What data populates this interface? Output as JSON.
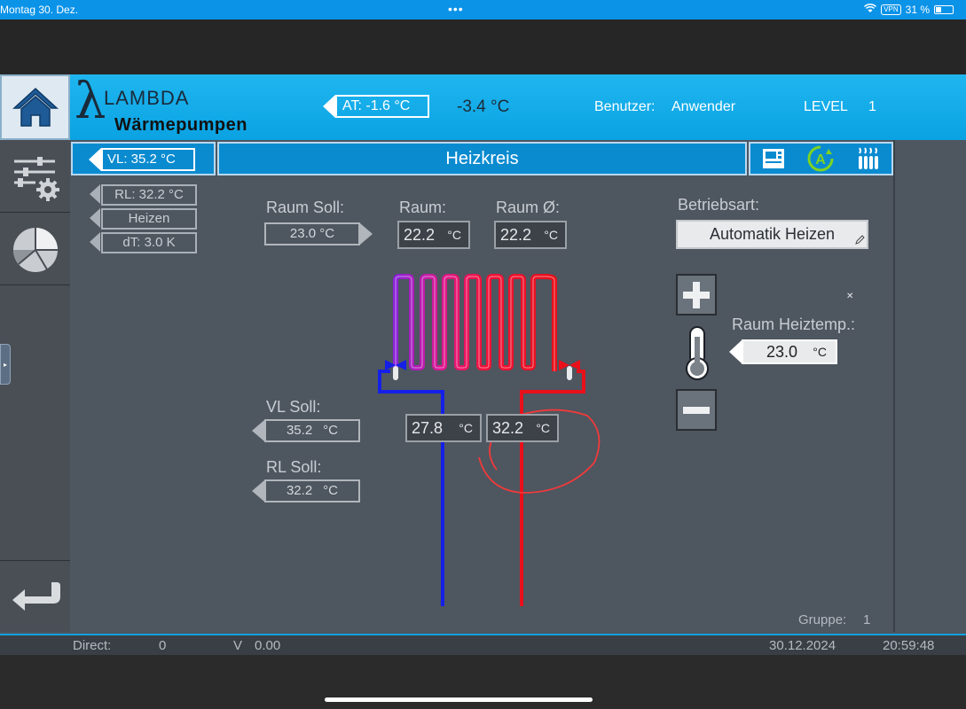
{
  "status_bar": {
    "date": "Montag 30. Dez.",
    "vpn": "VPN",
    "battery": "31 %"
  },
  "header": {
    "logo_name": "LAMBDA",
    "logo_subtitle": "Wärmepumpen",
    "outdoor_label": "AT:  -1.6 °C",
    "outdoor_avg": "-3.4 °C",
    "user_label": "Benutzer:",
    "user_value": "Anwender",
    "level_label": "LEVEL",
    "level_value": "1"
  },
  "subheader": {
    "vl_value": "VL: 35.2 °C",
    "title": "Heizkreis"
  },
  "status_fields": {
    "rl": "RL: 32.2 °C",
    "mode": "Heizen",
    "dt": "dT:   3.0 K"
  },
  "room": {
    "setpoint_label": "Raum Soll:",
    "setpoint_value": "23.0  °C",
    "current_label": "Raum:",
    "current_value": "22.2",
    "avg_label": "Raum Ø:",
    "avg_value": "22.2",
    "unit": "°C"
  },
  "betriebsart": {
    "label": "Betriebsart:",
    "value": "Automatik Heizen"
  },
  "heiztemp": {
    "label": "Raum Heiztemp.:",
    "value": "23.0",
    "unit": "°C"
  },
  "flow": {
    "vl_soll_label": "VL Soll:",
    "vl_soll_value": "35.2",
    "rl_soll_label": "RL Soll:",
    "rl_soll_value": "32.2",
    "unit": "°C",
    "return_temp": "27.8",
    "supply_temp": "32.2"
  },
  "group": {
    "label": "Gruppe:",
    "value": "1"
  },
  "footer": {
    "direct_label": "Direct:",
    "direct_value": "0",
    "v_label": "V",
    "v_value": "0.00",
    "date": "30.12.2024",
    "time": "20:59:48"
  },
  "colors": {
    "accent": "#0a8bd0",
    "supply": "#e8101a",
    "return": "#1420e8",
    "status": "#7ed321"
  }
}
